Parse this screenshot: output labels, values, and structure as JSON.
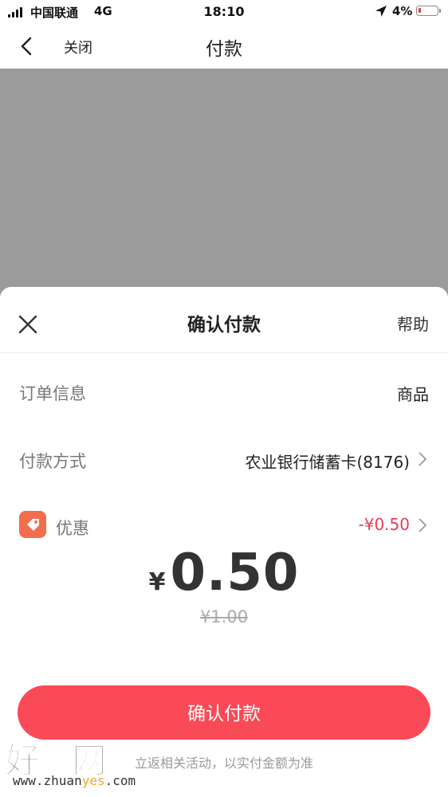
{
  "status_bar": {
    "carrier": "中国联通",
    "network": "4G",
    "time": "18:10",
    "battery": "4%",
    "battery_level": 0.04
  },
  "nav": {
    "close_label": "关闭",
    "title": "付款",
    "back_icon": "chevron-left-icon"
  },
  "sheet": {
    "title": "确认付款",
    "help_label": "帮助",
    "close_icon": "close-icon",
    "order_info_label": "订单信息",
    "order_info_value": "商品",
    "payment_method_label": "付款方式",
    "payment_method_value": "农业银行储蓄卡(8176)",
    "discount_label": "优惠",
    "discount_value": "-¥0.50",
    "currency_symbol": "¥",
    "amount": "0.50",
    "original_amount": "¥1.00",
    "confirm_button": "确认付款",
    "note": "立返相关活动，以实付金额为准"
  },
  "watermark": {
    "big": "好赚网",
    "small_prefix": "www.zhuan",
    "small_highlight": "yes",
    "small_suffix": ".com"
  },
  "colors": {
    "accent": "#fa4a57",
    "discount_red": "#e83d55",
    "overlay_gray": "#9b9b9b",
    "coupon_orange": "#f26d4e"
  }
}
